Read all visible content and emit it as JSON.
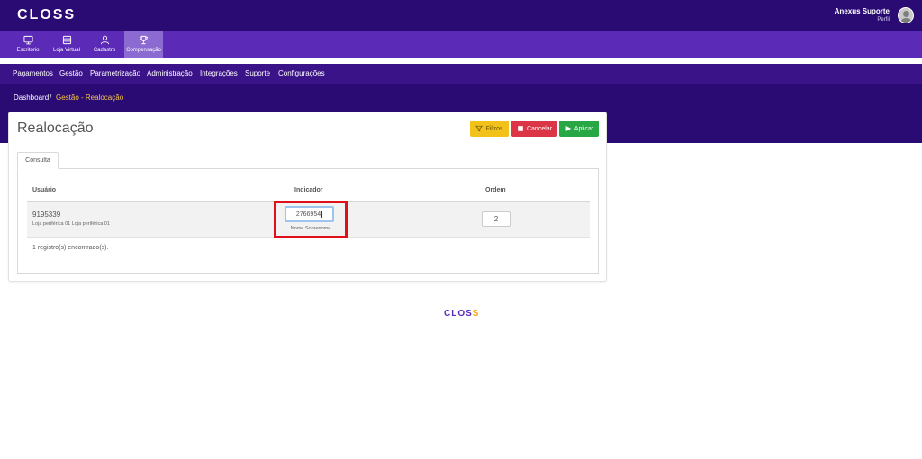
{
  "header": {
    "logo_text": "CLOSS",
    "user_name": "Anexus Suporte",
    "user_profile": "Perfil"
  },
  "modules": [
    {
      "label": "Escritório",
      "icon": "monitor-icon",
      "active": false
    },
    {
      "label": "Loja Virtual",
      "icon": "store-icon",
      "active": false
    },
    {
      "label": "Cadastro",
      "icon": "user-icon",
      "active": false
    },
    {
      "label": "Compensação",
      "icon": "trophy-icon",
      "active": true
    }
  ],
  "menu": [
    "Pagamentos",
    "Gestão",
    "Parametrização",
    "Administração",
    "Integrações",
    "Suporte",
    "Configurações"
  ],
  "breadcrumb": {
    "home": "Dashboard",
    "separator": "/",
    "current": "Gestão - Realocação"
  },
  "page": {
    "title": "Realocação",
    "buttons": {
      "filters": "Filtros",
      "cancel": "Cancelar",
      "apply": "Aplicar"
    },
    "tab": "Consulta"
  },
  "table": {
    "columns": [
      "Usuário",
      "Indicador",
      "Ordem"
    ],
    "rows": [
      {
        "user_id": "9195339",
        "user_store": "Loja periférica 01 Loja periférica 01",
        "indicator_value": "2766954",
        "indicator_name": "Nome Sobrenome",
        "order_value": "2"
      }
    ],
    "records_found": "1 registro(s) encontrado(s)."
  },
  "footer": {
    "logo_part1": "CLOS",
    "logo_part2": "S"
  },
  "colors": {
    "topbar": "#2a0b74",
    "modbar": "#5b2ab7",
    "highlight": "#e0101a",
    "filters": "#f2c21b",
    "cancel": "#dc3545",
    "apply": "#28a745"
  }
}
